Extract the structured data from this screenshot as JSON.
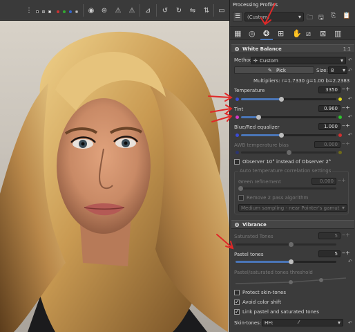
{
  "panel": {
    "title": "Processing Profiles",
    "profile_value": "(Custom)",
    "white_balance": {
      "title": "White Balance",
      "method_label": "Method:",
      "method_value": "Custom",
      "pick_label": "Pick",
      "size_label": "Size:",
      "size_value": "8",
      "multipliers": "Multipliers: r=1.7330 g=1.00 b=2.2383",
      "temperature": {
        "label": "Temperature",
        "value": "3350",
        "level": 0.42
      },
      "tint": {
        "label": "Tint",
        "value": "0.960",
        "level": 0.18
      },
      "blue_red": {
        "label": "Blue/Red equalizer",
        "value": "1.000",
        "level": 0.42
      },
      "awb_bias": {
        "label": "AWB temperature bias",
        "value": "0.000"
      },
      "observer_label": "Observer 10° instead of Observer 2°",
      "correlation": {
        "title": "Auto temperature correlation settings",
        "green_label": "Green refinement",
        "green_value": "0.000",
        "remove_label": "Remove 2 pass algorithm",
        "sampling_value": "Medium sampling - near Pointer's gamut"
      }
    },
    "vibrance": {
      "title": "Vibrance",
      "saturated": {
        "label": "Saturated Tones",
        "value": "5"
      },
      "pastel": {
        "label": "Pastel tones",
        "value": "5",
        "level": 0.55
      },
      "threshold_label": "Pastel/saturated tones threshold",
      "protect_label": "Protect skin-tones",
      "avoid_label": "Avoid color shift",
      "link_label": "Link pastel and saturated tones",
      "skin_label": "Skin-tones:",
      "skin_value": "HH:"
    }
  },
  "colors": {
    "accent": "#4a76b8",
    "annotation_red": "#e02828"
  },
  "icons": [
    "toolbar-icon",
    "save-icon",
    "folder-icon",
    "copy-icon",
    "paste-icon",
    "exposure-tab-icon",
    "detail-tab-icon",
    "color-tab-icon",
    "advanced-tab-icon",
    "transform-tab-icon",
    "raw-tab-icon",
    "metadata-tab-icon"
  ]
}
